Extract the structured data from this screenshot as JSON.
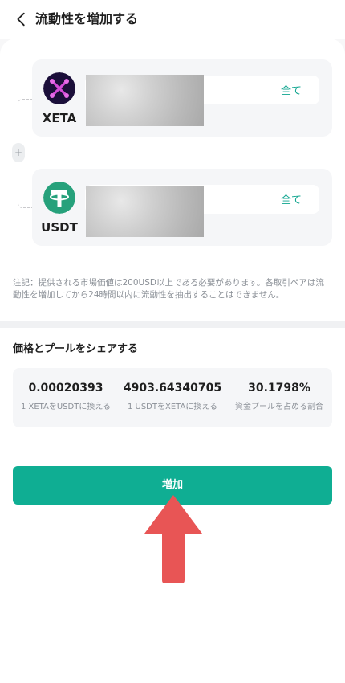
{
  "header": {
    "title": "流動性を増加する"
  },
  "tokens": {
    "xeta": {
      "symbol": "XETA",
      "max_label": "全て",
      "amount": ""
    },
    "usdt": {
      "symbol": "USDT",
      "max_label": "全て",
      "amount": ""
    }
  },
  "notice": "注記：提供される市場価値は200USD以上である必要があります。各取引ペアは流動性を増加してから24時間以内に流動性を抽出することはできません。",
  "price_section": {
    "title": "価格とプールをシェアする",
    "stats": [
      {
        "value": "0.00020393",
        "label": "1 XETAをUSDTに換える"
      },
      {
        "value": "4903.64340705",
        "label": "1 USDTをXETAに換える"
      },
      {
        "value": "30.1798%",
        "label": "資金プールを占める割合"
      }
    ]
  },
  "actions": {
    "add_label": "増加"
  },
  "colors": {
    "accent": "#0fae93",
    "arrow": "#e85555",
    "xeta_purple": "#d44bd8",
    "usdt_green": "#26a17b"
  },
  "icons": {
    "back": "chevron-left-icon",
    "xeta_logo": "xeta-logo-icon",
    "usdt_logo": "usdt-logo-icon",
    "plus": "plus-icon"
  }
}
